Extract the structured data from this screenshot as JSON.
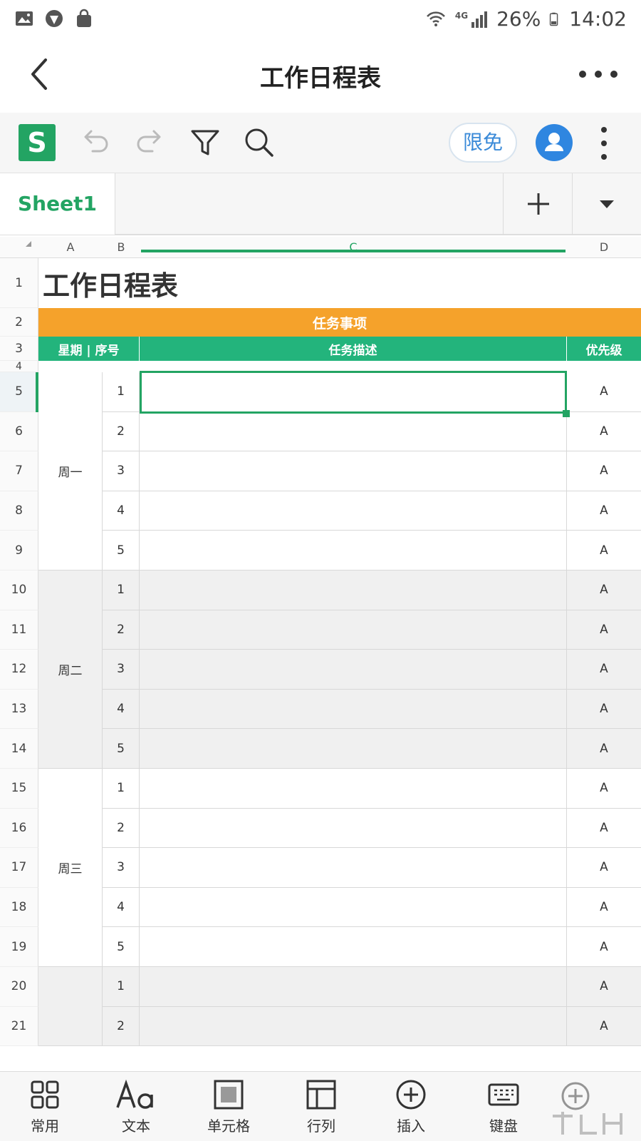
{
  "status_bar": {
    "battery": "26%",
    "time": "14:02",
    "network": "4G"
  },
  "header": {
    "title": "工作日程表"
  },
  "toolbar": {
    "promo_label": "限免",
    "app_logo_letter": "S"
  },
  "sheets": {
    "active_tab": "Sheet1"
  },
  "columns": [
    "A",
    "B",
    "C",
    "D"
  ],
  "sheet": {
    "title": "工作日程表",
    "section_header": "任务事项",
    "header_weekday_seq": "星期 | 序号",
    "header_description": "任务描述",
    "header_priority": "优先级",
    "row_numbers": [
      "1",
      "2",
      "3",
      "4",
      "5",
      "6",
      "7",
      "8",
      "9",
      "10",
      "11",
      "12",
      "13",
      "14",
      "15",
      "16",
      "17",
      "18",
      "19",
      "20",
      "21"
    ],
    "groups": [
      {
        "day": "周一",
        "seq": [
          "1",
          "2",
          "3",
          "4",
          "5"
        ],
        "priority": [
          "A",
          "A",
          "A",
          "A",
          "A"
        ]
      },
      {
        "day": "周二",
        "seq": [
          "1",
          "2",
          "3",
          "4",
          "5"
        ],
        "priority": [
          "A",
          "A",
          "A",
          "A",
          "A"
        ]
      },
      {
        "day": "周三",
        "seq": [
          "1",
          "2",
          "3",
          "4",
          "5"
        ],
        "priority": [
          "A",
          "A",
          "A",
          "A",
          "A"
        ]
      },
      {
        "day": "",
        "seq": [
          "1",
          "2"
        ],
        "priority": [
          "A",
          "A"
        ]
      }
    ]
  },
  "bottom_bar": {
    "items": [
      "常用",
      "文本",
      "单元格",
      "行列",
      "插入",
      "键盘"
    ]
  },
  "colors": {
    "accent_green": "#23a463",
    "header_orange": "#f5a22b",
    "header_green": "#23b47c"
  }
}
